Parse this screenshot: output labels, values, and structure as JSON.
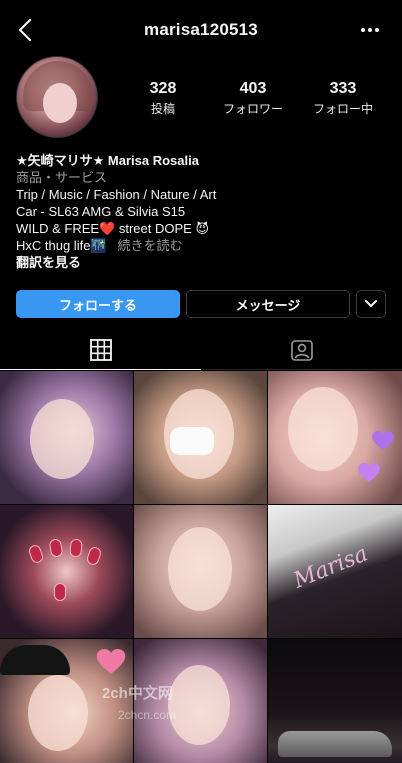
{
  "header": {
    "username": "marisa120513",
    "back_icon": "chevron-left-icon",
    "more_icon": "more-horizontal-icon"
  },
  "profile": {
    "avatar": "avatar",
    "stats": [
      {
        "value": "328",
        "label": "投稿"
      },
      {
        "value": "403",
        "label": "フォロワー"
      },
      {
        "value": "333",
        "label": "フォロー中"
      }
    ]
  },
  "bio": {
    "name": "★矢崎マリサ★ Marisa Rosalia",
    "category": "商品・サービス",
    "line1": "Trip / Music / Fashion / Nature / Art",
    "line2": "Car - SL63 AMG & Silvia S15",
    "line3": "WILD & FREE❤️ street DOPE 😈",
    "line4": "HxC thug life🌃",
    "more": "続きを読む",
    "translate": "翻訳を見る"
  },
  "buttons": {
    "follow": "フォローする",
    "message": "メッセージ",
    "dropdown_icon": "chevron-down-icon"
  },
  "tabs": [
    {
      "name": "grid",
      "icon": "grid-icon",
      "active": true
    },
    {
      "name": "tagged",
      "icon": "tagged-person-icon",
      "active": false
    }
  ],
  "posts": {
    "count_visible": 9,
    "case_text": "Marisa"
  },
  "watermark": {
    "line1": "2ch中文网",
    "line2": "2chcn.com"
  },
  "colors": {
    "background": "#000000",
    "accent": "#3897f0",
    "secondary_text": "#9a9a9a"
  }
}
